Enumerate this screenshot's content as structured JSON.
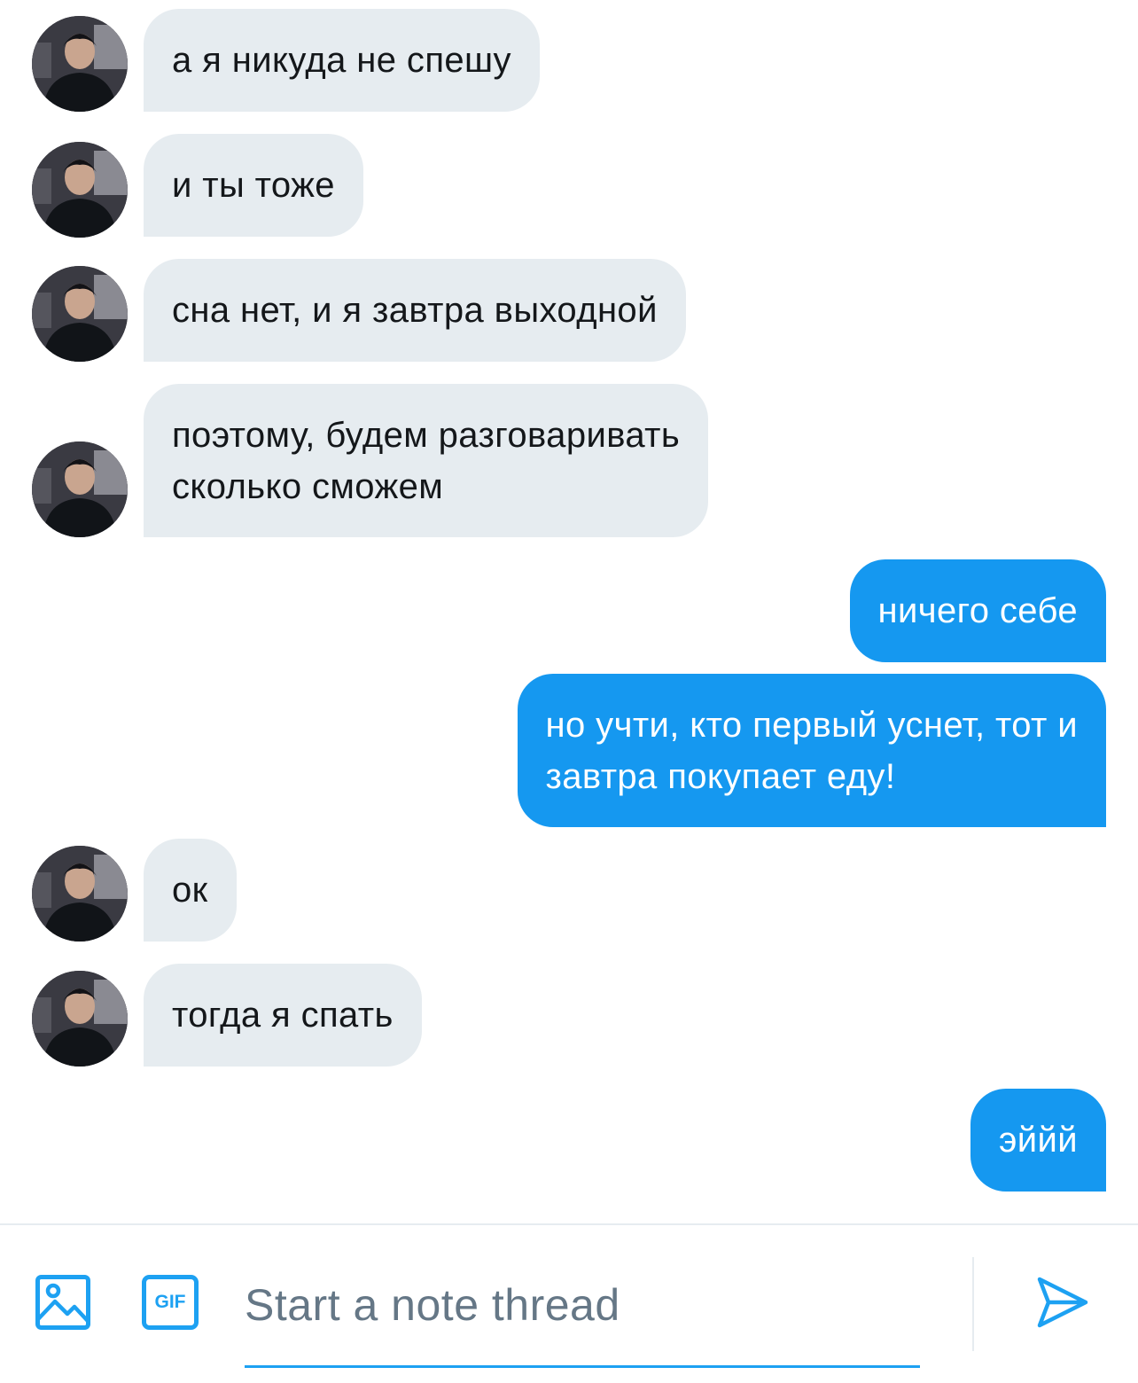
{
  "colors": {
    "incoming_bubble": "#e6ecf0",
    "outgoing_bubble": "#1598f0",
    "accent": "#1da1f2",
    "incoming_text": "#14171a",
    "outgoing_text": "#ffffff",
    "placeholder": "#657786"
  },
  "messages": [
    {
      "direction": "in",
      "text": "а я никуда не спешу"
    },
    {
      "direction": "in",
      "text": "и ты тоже"
    },
    {
      "direction": "in",
      "text": "сна нет, и я завтра выходной"
    },
    {
      "direction": "in",
      "text": "поэтому, будем разговаривать\nсколько сможем"
    },
    {
      "direction": "out",
      "text": "ничего себе"
    },
    {
      "direction": "out",
      "text": "но учти, кто первый уснет, тот и\nзавтра покупает еду!"
    },
    {
      "direction": "in",
      "text": "ок"
    },
    {
      "direction": "in",
      "text": "тогда я спать"
    },
    {
      "direction": "out",
      "text": "эййй"
    }
  ],
  "composer": {
    "media_icon": "image-icon",
    "gif_icon": "gif-icon",
    "gif_label": "GIF",
    "placeholder": "Start a note thread",
    "value": "",
    "send_icon": "send-icon"
  }
}
